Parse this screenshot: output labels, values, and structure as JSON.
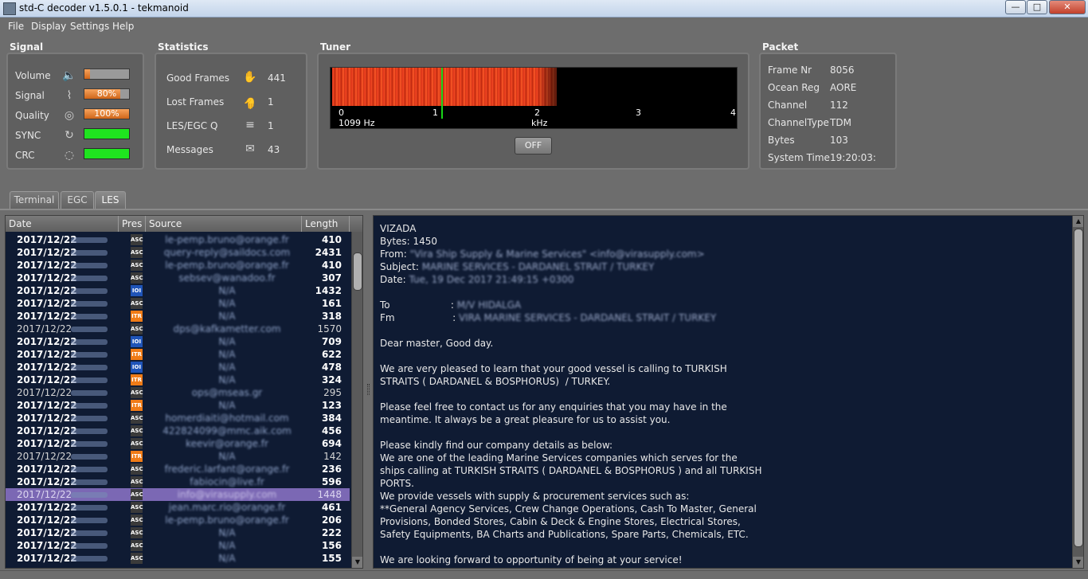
{
  "window": {
    "title": "std-C decoder v1.5.0.1 - tekmanoid"
  },
  "menu": [
    "File",
    "Display",
    "Settings",
    "Help"
  ],
  "signal": {
    "title": "Signal",
    "rows": [
      {
        "label": "Volume",
        "icon": "speaker-icon",
        "level": 0.12,
        "text": ""
      },
      {
        "label": "Signal",
        "icon": "signal-icon",
        "level": 0.8,
        "text": "80%"
      },
      {
        "label": "Quality",
        "icon": "target-icon",
        "level": 1.0,
        "text": "100%"
      },
      {
        "label": "SYNC",
        "icon": "sync-icon",
        "level": 1.0,
        "text": ""
      },
      {
        "label": "CRC",
        "icon": "fingerprint-icon",
        "level": 1.0,
        "text": ""
      }
    ]
  },
  "statistics": {
    "title": "Statistics",
    "rows": [
      {
        "label": "Good Frames",
        "icon": "thumbs-up-icon",
        "value": "441"
      },
      {
        "label": "Lost Frames",
        "icon": "thumbs-down-icon",
        "value": "1"
      },
      {
        "label": "LES/EGC Q",
        "icon": "queue-icon",
        "value": "1"
      },
      {
        "label": "Messages",
        "icon": "envelope-icon",
        "value": "43"
      }
    ]
  },
  "tuner": {
    "title": "Tuner",
    "ticks": [
      "0",
      "1",
      "2",
      "3",
      "4"
    ],
    "freq": "1099 Hz",
    "unit": "kHz",
    "button": "OFF"
  },
  "packet": {
    "title": "Packet",
    "rows": [
      {
        "label": "Frame Nr",
        "value": "8056"
      },
      {
        "label": "Ocean Reg",
        "value": "AORE"
      },
      {
        "label": "Channel",
        "value": "112"
      },
      {
        "label": "ChannelType",
        "value": "TDM"
      },
      {
        "label": "Bytes",
        "value": "103"
      },
      {
        "label": "System Time",
        "value": "19:20:03:"
      }
    ]
  },
  "tabs": [
    "Terminal",
    "EGC",
    "LES"
  ],
  "table": {
    "headers": [
      "Date",
      "Pres",
      "Source",
      "Length"
    ],
    "rows": [
      {
        "date": "2017/12/22",
        "pres": "ASC",
        "source": "le-pemp.bruno@orange.fr",
        "length": "410",
        "bold": true
      },
      {
        "date": "2017/12/22",
        "pres": "ASC",
        "source": "query-reply@saildocs.com",
        "length": "2431",
        "bold": true
      },
      {
        "date": "2017/12/22",
        "pres": "ASC",
        "source": "le-pemp.bruno@orange.fr",
        "length": "410",
        "bold": true
      },
      {
        "date": "2017/12/22",
        "pres": "ASC",
        "source": "sebsev@wanadoo.fr",
        "length": "307",
        "bold": true
      },
      {
        "date": "2017/12/22",
        "pres": "IOI",
        "source": "N/A",
        "length": "1432",
        "bold": true
      },
      {
        "date": "2017/12/22",
        "pres": "ASC",
        "source": "N/A",
        "length": "161",
        "bold": true
      },
      {
        "date": "2017/12/22",
        "pres": "ITR",
        "source": "N/A",
        "length": "318",
        "bold": true
      },
      {
        "date": "2017/12/22",
        "pres": "ASC",
        "source": "dps@kafkametter.com",
        "length": "1570",
        "bold": false
      },
      {
        "date": "2017/12/22",
        "pres": "IOI",
        "source": "N/A",
        "length": "709",
        "bold": true
      },
      {
        "date": "2017/12/22",
        "pres": "ITR",
        "source": "N/A",
        "length": "622",
        "bold": true
      },
      {
        "date": "2017/12/22",
        "pres": "IOI",
        "source": "N/A",
        "length": "478",
        "bold": true
      },
      {
        "date": "2017/12/22",
        "pres": "ITR",
        "source": "N/A",
        "length": "324",
        "bold": true
      },
      {
        "date": "2017/12/22",
        "pres": "ASC",
        "source": "ops@mseas.gr",
        "length": "295",
        "bold": false
      },
      {
        "date": "2017/12/22",
        "pres": "ITR",
        "source": "N/A",
        "length": "123",
        "bold": true
      },
      {
        "date": "2017/12/22",
        "pres": "ASC",
        "source": "homerdiaiti@hotmail.com",
        "length": "384",
        "bold": true
      },
      {
        "date": "2017/12/22",
        "pres": "ASC",
        "source": "422824099@mmc.aik.com",
        "length": "456",
        "bold": true
      },
      {
        "date": "2017/12/22",
        "pres": "ASC",
        "source": "keevir@orange.fr",
        "length": "694",
        "bold": true
      },
      {
        "date": "2017/12/22",
        "pres": "ITR",
        "source": "N/A",
        "length": "142",
        "bold": false
      },
      {
        "date": "2017/12/22",
        "pres": "ASC",
        "source": "frederic.larfant@orange.fr",
        "length": "236",
        "bold": true
      },
      {
        "date": "2017/12/22",
        "pres": "ASC",
        "source": "fabiocin@live.fr",
        "length": "596",
        "bold": true
      },
      {
        "date": "2017/12/22",
        "pres": "ASC",
        "source": "info@virasupply.com",
        "length": "1448",
        "bold": false,
        "selected": true
      },
      {
        "date": "2017/12/22",
        "pres": "ASC",
        "source": "jean.marc.rio@orange.fr",
        "length": "461",
        "bold": true
      },
      {
        "date": "2017/12/22",
        "pres": "ASC",
        "source": "le-pemp.bruno@orange.fr",
        "length": "206",
        "bold": true
      },
      {
        "date": "2017/12/22",
        "pres": "ASC",
        "source": "N/A",
        "length": "222",
        "bold": true
      },
      {
        "date": "2017/12/22",
        "pres": "ASC",
        "source": "N/A",
        "length": "156",
        "bold": true
      },
      {
        "date": "2017/12/22",
        "pres": "ASC",
        "source": "N/A",
        "length": "155",
        "bold": true
      }
    ]
  },
  "message": {
    "lines": [
      {
        "t": "VIZADA"
      },
      {
        "t": "Bytes: 1450"
      },
      {
        "t": "From: ",
        "b": "\"Vira Ship Supply & Marine Services\" <info@virasupply.com>"
      },
      {
        "t": "Subject: ",
        "b": "MARINE SERVICES - DARDANEL STRAIT / TURKEY"
      },
      {
        "t": "Date: ",
        "b": "Tue, 19 Dec 2017 21:49:15 +0300"
      },
      {
        "t": ""
      },
      {
        "t": "To                    : ",
        "b": "M/V HIDALGA"
      },
      {
        "t": "Fm                   : ",
        "b": "VIRA MARINE SERVICES - DARDANEL STRAIT / TURKEY"
      },
      {
        "t": ""
      },
      {
        "t": "Dear master, Good day."
      },
      {
        "t": ""
      },
      {
        "t": "We are very pleased to learn that your good vessel is calling to TURKISH"
      },
      {
        "t": "STRAITS ( DARDANEL & BOSPHORUS)  / TURKEY."
      },
      {
        "t": ""
      },
      {
        "t": "Please feel free to contact us for any enquiries that you may have in the"
      },
      {
        "t": "meantime. It always be a great pleasure for us to assist you."
      },
      {
        "t": ""
      },
      {
        "t": "Please kindly find our company details as below:"
      },
      {
        "t": "We are one of the leading Marine Services companies which serves for the"
      },
      {
        "t": "ships calling at TURKISH STRAITS ( DARDANEL & BOSPHORUS ) and all TURKISH"
      },
      {
        "t": "PORTS."
      },
      {
        "t": "We provide vessels with supply & procurement services such as:"
      },
      {
        "t": "**General Agency Services, Crew Change Operations, Cash To Master, General"
      },
      {
        "t": "Provisions, Bonded Stores, Cabin & Deck & Engine Stores, Electrical Stores,"
      },
      {
        "t": "Safety Equipments, BA Charts and Publications, Spare Parts, Chemicals, ETC."
      },
      {
        "t": ""
      },
      {
        "t": "We are looking forward to opportunity of being at your service!"
      }
    ]
  }
}
